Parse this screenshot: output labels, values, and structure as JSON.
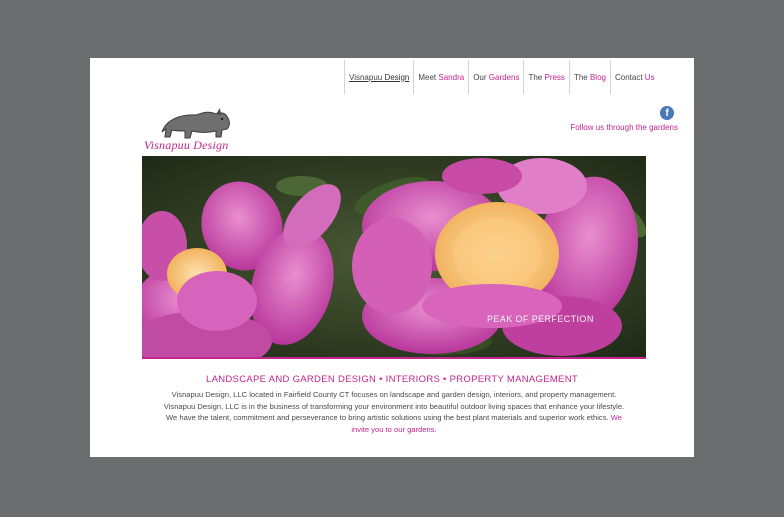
{
  "brand": {
    "name": "Visnapuu Design"
  },
  "nav": {
    "items": [
      {
        "pre": "Visnapuu",
        "acc": "Design",
        "active": true
      },
      {
        "pre": "Meet",
        "acc": "Sandra"
      },
      {
        "pre": "Our",
        "acc": "Gardens"
      },
      {
        "pre": "The",
        "acc": "Press"
      },
      {
        "pre": "The",
        "acc": "Blog"
      },
      {
        "pre": "Contact",
        "acc": "Us"
      }
    ]
  },
  "social": {
    "follow_text": "Follow us through the gardens",
    "icon": "facebook-icon"
  },
  "hero": {
    "caption": "PEAK OF PERFECTION"
  },
  "tagline": "LANDSCAPE AND GARDEN DESIGN • INTERIORS • PROPERTY MANAGEMENT",
  "intro": {
    "text": "Visnapuu Design, LLC located in Fairfield County CT focuses on landscape and garden design, interiors, and property management. Visnapuu Design, LLC is in the business of transforming your environment into beautiful outdoor living spaces that enhance your lifestyle. We have the talent, commitment and perseverance to bring artistic solutions using the best plant materials and superior work ethics.",
    "invite": "We invite you to our gardens."
  },
  "colors": {
    "accent": "#c2258f",
    "frame": "#6b6d6f",
    "facebook": "#4b79b5"
  }
}
